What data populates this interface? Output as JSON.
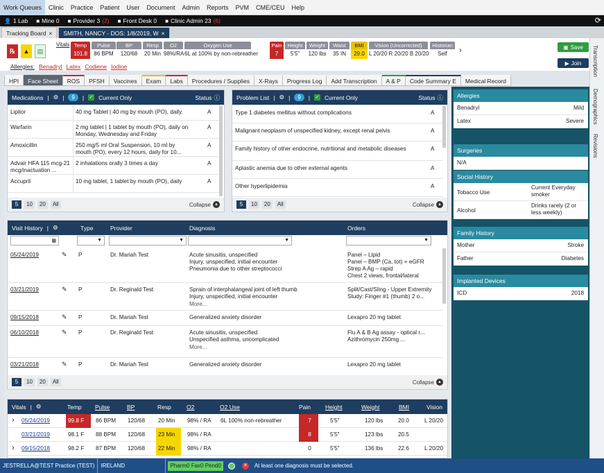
{
  "menu": [
    "Work Queues",
    "Clinic",
    "Practice",
    "Patient",
    "User",
    "Document",
    "Admin",
    "Reports",
    "PVM",
    "CME/CEU",
    "Help"
  ],
  "queues": [
    {
      "label": "1 Lab",
      "count": ""
    },
    {
      "label": "Mine 0",
      "count": ""
    },
    {
      "label": "Provider 3",
      "count": "(2)"
    },
    {
      "label": "Front Desk 0",
      "count": ""
    },
    {
      "label": "Clinic Admin 23",
      "count": "(6)"
    }
  ],
  "tabs": {
    "tracking": "Tracking Board",
    "patient": "SMITH, NANCY - DOS: 1/8/2019, W",
    "close": "×"
  },
  "vitals_label": "Vitals",
  "vitals": [
    {
      "h": "Temp",
      "v": "101.8"
    },
    {
      "h": "Pulse",
      "v": "86 BPM"
    },
    {
      "h": "BP",
      "v": "120/68"
    },
    {
      "h": "Resp",
      "v": "20 Min"
    },
    {
      "h": "O2",
      "v": "98%/RA"
    },
    {
      "h": "Oxygen Use",
      "v": "6L at 100% by non-rebreather"
    },
    {
      "h": "Pain",
      "v": "7"
    },
    {
      "h": "Height",
      "v": "5'5\""
    },
    {
      "h": "Weight",
      "v": "120 lbs"
    },
    {
      "h": "Waist",
      "v": "35 IN"
    },
    {
      "h": "BMI",
      "v": "29.0"
    },
    {
      "h": "Vision (Uncorrected)",
      "v": "L 20/20 R 20/20 B 20/20"
    },
    {
      "h": "Historian",
      "v": "Self"
    }
  ],
  "allergies_label": "Allergies:",
  "allergies": [
    "Benadryl",
    "Latex",
    "Codiene",
    "Iodine"
  ],
  "save_label": "Save",
  "join_label": "Join",
  "section_tabs": [
    "HPI",
    "Face Sheet",
    "ROS",
    "PFSH",
    "Vaccines",
    "Exam",
    "Labs",
    "Procedures / Supplies",
    "X-Rays",
    "Progress Log",
    "Add Transcription",
    "A & P",
    "Code Summary E",
    "Medical Record"
  ],
  "side_tabs": [
    "Transcription",
    "Demographics",
    "Revisions"
  ],
  "medications": {
    "title": "Medications",
    "count": "9",
    "current_only": "Current Only",
    "status": "Status",
    "rows": [
      {
        "name": "Lipitor",
        "desc": "40 mg Tablet | 40 mg by mouth (PO), daily.",
        "status": "A"
      },
      {
        "name": "Warfarin",
        "desc": "2 mg tablet | 1 tablet by mouth (PO), daily on Monday, Wednesday and Friday",
        "status": "A"
      },
      {
        "name": "Amoxicillin",
        "desc": "250 mg/5 ml Oral Suspension, 10 ml by mouth (PO), every 12 hours, daily for 10...",
        "status": "A"
      },
      {
        "name": "Advair HFA 115 mcg-21 mcg/inactuation ...",
        "desc": "2 inhalations orally 3 times a day",
        "status": "A"
      },
      {
        "name": "Accupril",
        "desc": "10 mg tablet, 1 tablet by mouth (PO), daily",
        "status": "A"
      }
    ],
    "pages": [
      "5",
      "10",
      "20",
      "All"
    ],
    "collapse": "Collapse"
  },
  "problems": {
    "title": "Problem List",
    "count": "9",
    "current_only": "Current Only",
    "status": "Status",
    "rows": [
      {
        "desc": "Type 1 diabetes mellitus without complications",
        "status": "A"
      },
      {
        "desc": "Malignant neoplasm of unspecified kidney, except renal pelvis",
        "status": "A"
      },
      {
        "desc": "Family history of other endocrine, nutritional and metabolic diseases",
        "status": "A"
      },
      {
        "desc": "Aplastic anemia due to other external agents",
        "status": "A"
      },
      {
        "desc": "Other hyperlipidemia",
        "status": "A"
      }
    ],
    "pages": [
      "5",
      "10",
      "20",
      "All"
    ],
    "collapse": "Collapse"
  },
  "visits": {
    "title": "Visit History",
    "headers": [
      "Type",
      "Provider",
      "Diagnosis",
      "Orders"
    ],
    "rows": [
      {
        "date": "05/24/2019",
        "type": "P",
        "provider": "Dr. Mariah Test",
        "dx": [
          "Acute sinusitis, unspecified",
          "Injury, unspecified, initial encounter",
          "Pneumonia due to other streptococci"
        ],
        "more": "",
        "orders": [
          "Panel – Lipid",
          "Panel – BMP (Ca, tot) + eGFR",
          "Strep A Ag – rapid",
          "Chest 2 views, frontal/lateral"
        ]
      },
      {
        "date": "03/21/2019",
        "type": "P",
        "provider": "Dr. Reginald Test",
        "dx": [
          "Sprain of interphalangeal joint of left thumb",
          "Injury, unspecified, initial encounter"
        ],
        "more": "More...",
        "orders": [
          "Split/Cast/Sling - Upper Extremity",
          "Study: Finger #1 (thumb) 2 o..."
        ]
      },
      {
        "date": "09/15/2018",
        "type": "P",
        "provider": "Dr. Mariah Test",
        "dx": [
          "Generalized anxiety disorder"
        ],
        "more": "",
        "orders": [
          "Lexapro 20 mg tablet"
        ]
      },
      {
        "date": "06/10/2018",
        "type": "P",
        "provider": "Dr. Reginald Test",
        "dx": [
          "Acute sinusitis, unspecified",
          "Unspecified asthma, uncomplicated"
        ],
        "more": "More...",
        "orders": [
          "Flu A & B Ag assay - optical r...",
          "Azithromycin 250mg ..."
        ]
      },
      {
        "date": "03/21/2018",
        "type": "P",
        "provider": "Dr. Mariah Test",
        "dx": [
          "Generalized anxiety disorder"
        ],
        "more": "",
        "orders": [
          "Lexapro 20 mg tablet"
        ]
      }
    ],
    "pages": [
      "5",
      "10",
      "20",
      "All"
    ],
    "collapse": "Collapse"
  },
  "vitals_table": {
    "title": "Vitals",
    "headers": [
      "Temp",
      "Pulse",
      "BP",
      "Resp",
      "O2",
      "O2 Use",
      "Pain",
      "Height",
      "Weight",
      "BMI",
      "Vision"
    ],
    "rows": [
      {
        "date": "05/24/2019",
        "temp": "99.8 F",
        "pulse": "86 BPM",
        "bp": "120/68",
        "resp": "20 Min",
        "o2": "98% / RA",
        "o2use": "6L 100% non-rebreather",
        "pain": "7",
        "height": "5'5\"",
        "weight": "120 lbs",
        "bmi": "20.0",
        "vision": "L 20/20"
      },
      {
        "date": "03/21/2019",
        "temp": "98.1 F",
        "pulse": "88 BPM",
        "bp": "120/68",
        "resp": "23 Min",
        "o2": "98% / RA",
        "o2use": "",
        "pain": "8",
        "height": "5'5\"",
        "weight": "123 lbs",
        "bmi": "20.5",
        "vision": ""
      },
      {
        "date": "09/15/2018",
        "temp": "98.2 F",
        "pulse": "87 BPM",
        "bp": "120/68",
        "resp": "22 Min",
        "o2": "98% / RA",
        "o2use": "",
        "pain": "0",
        "height": "5'5\"",
        "weight": "136 lbs",
        "bmi": "22.6",
        "vision": "L 20/20"
      }
    ]
  },
  "right": {
    "allergies": {
      "title": "Allergies",
      "rows": [
        [
          "Benadryl",
          "Mild"
        ],
        [
          "Latex",
          "Severe"
        ]
      ]
    },
    "surgeries": {
      "title": "Surgeries",
      "rows": [
        [
          "N/A",
          ""
        ]
      ]
    },
    "social": {
      "title": "Social History",
      "rows": [
        [
          "Tobacco Use",
          "Current Everyday smoker"
        ],
        [
          "Alcohol",
          "Drinks rarely (2 or less weekly)"
        ]
      ]
    },
    "family": {
      "title": "Family History",
      "rows": [
        [
          "Mother",
          "Stroke"
        ],
        [
          "Father",
          "Diabetes"
        ]
      ]
    },
    "devices": {
      "title": "Implanted Devices",
      "rows": [
        [
          "ICD",
          "2018"
        ]
      ]
    }
  },
  "status": {
    "user": "JESTRELLA@TEST Practice (TEST)",
    "location": "IRELAND",
    "pharm": "Pharm0 Fax0 Pend0",
    "message": "At least one diagnosis must be selected."
  }
}
